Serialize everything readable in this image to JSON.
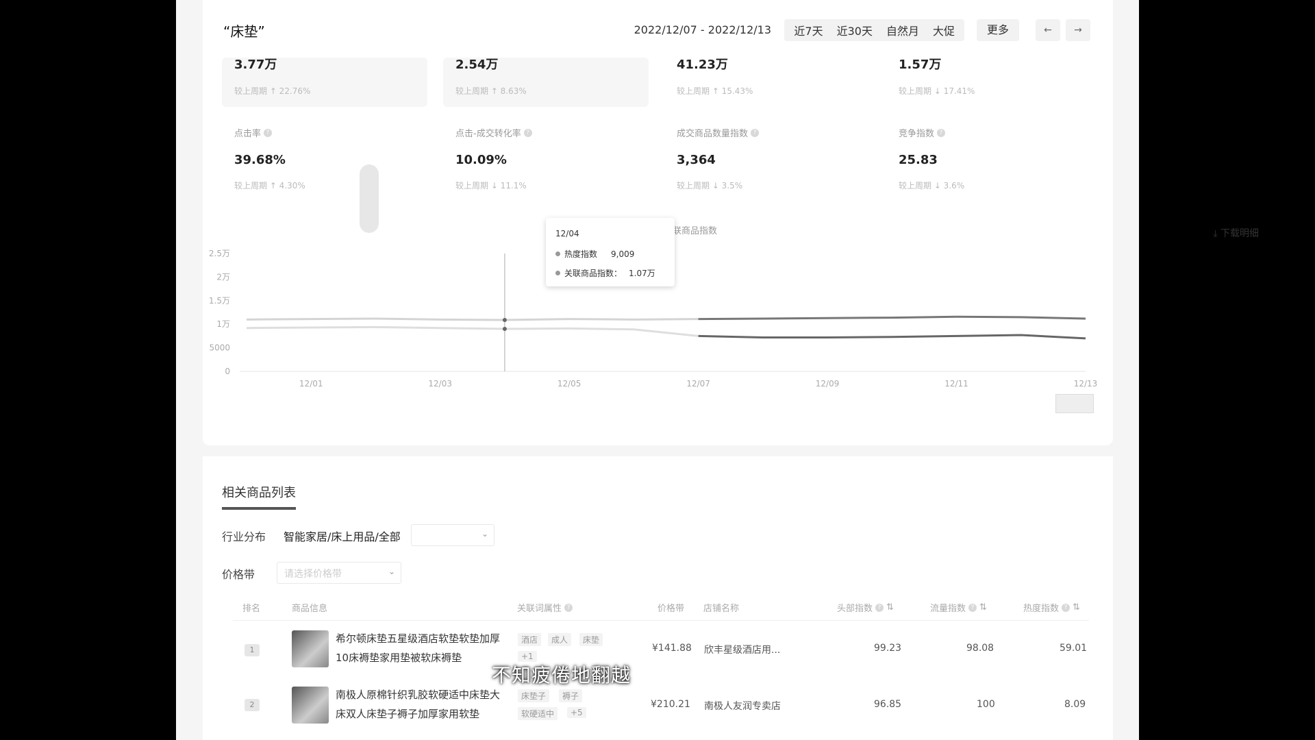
{
  "header": {
    "keyword": "“床垫”",
    "date_range": "2022/12/07 - 2022/12/13",
    "range_tabs": [
      "近7天",
      "近30天",
      "自然月",
      "大促"
    ],
    "more": "更多",
    "prev": "←",
    "next": "→"
  },
  "metrics_top": [
    {
      "value": "3.77万",
      "compare": "较上周期 ↑ 22.76%"
    },
    {
      "value": "2.54万",
      "compare": "较上周期 ↑ 8.63%"
    },
    {
      "value": "41.23万",
      "compare": "较上周期 ↑ 15.43%"
    },
    {
      "value": "1.57万",
      "compare": "较上周期 ↓ 17.41%"
    }
  ],
  "metrics_bottom": [
    {
      "name": "点击率",
      "value": "39.68%",
      "compare": "较上周期 ↑ 4.30%"
    },
    {
      "name": "点击-成交转化率",
      "value": "10.09%",
      "compare": "较上周期 ↓ 11.1%"
    },
    {
      "name": "成交商品数量指数",
      "value": "3,364",
      "compare": "较上周期 ↓ 3.5%"
    },
    {
      "name": "竞争指数",
      "value": "25.83",
      "compare": "较上周期 ↓ 3.6%"
    }
  ],
  "chart": {
    "legend_partial": "联商品指数",
    "download": "下载明细",
    "chart_data": {
      "type": "line",
      "x": [
        "11/30",
        "12/01",
        "12/02",
        "12/03",
        "12/04",
        "12/05",
        "12/06",
        "12/07",
        "12/08",
        "12/09",
        "12/10",
        "12/11",
        "12/12",
        "12/13"
      ],
      "x_tick_labels": [
        "12/01",
        "12/03",
        "12/05",
        "12/07",
        "12/09",
        "12/11",
        "12/13"
      ],
      "y_tick_labels": [
        "0",
        "5000",
        "1万",
        "1.5万",
        "2万",
        "2.5万"
      ],
      "ylim": [
        0,
        25000
      ],
      "series": [
        {
          "name": "热度指数",
          "values": [
            11000,
            11100,
            11200,
            11000,
            10900,
            11100,
            11000,
            11100,
            11200,
            11300,
            11400,
            11600,
            11500,
            11200
          ]
        },
        {
          "name": "关联商品指数",
          "values": [
            9200,
            9300,
            9400,
            9200,
            9009,
            9100,
            8900,
            7500,
            7200,
            7200,
            7300,
            7500,
            7700,
            7000
          ]
        }
      ],
      "highlight_index": 4
    },
    "tooltip": {
      "date": "12/04",
      "rows": [
        {
          "label": "热度指数",
          "value": "9,009"
        },
        {
          "label": "关联商品指数：",
          "value": "1.07万"
        }
      ]
    }
  },
  "products": {
    "section_title": "相关商品列表",
    "industry_label": "行业分布",
    "industry_value": "智能家居/床上用品/全部",
    "price_label": "价格带",
    "price_placeholder": "请选择价格带",
    "columns": [
      "排名",
      "商品信息",
      "关联词属性",
      "价格带",
      "店铺名称",
      "头部指数",
      "流量指数",
      "热度指数"
    ],
    "rows": [
      {
        "rank": "1",
        "name": "希尔顿床垫五星级酒店软垫软垫加厚10床褥垫家用垫被软床褥垫",
        "tags": [
          "酒店",
          "成人",
          "床垫"
        ],
        "extra_tag": "+1",
        "price": "¥141.88",
        "shop": "欣丰星级酒店用...",
        "idx1": "99.23",
        "idx2": "98.08",
        "idx3": "59.01"
      },
      {
        "rank": "2",
        "name": "南极人原棉针织乳胶软硬适中床垫大床双人床垫子褥子加厚家用软垫",
        "tags": [
          "床垫子",
          "褥子",
          "软硬适中",
          "+5"
        ],
        "extra_tag": "",
        "price": "¥210.21",
        "shop": "南极人友润专卖店",
        "idx1": "96.85",
        "idx2": "100",
        "idx3": "8.09"
      }
    ]
  },
  "subtitle": "不知疲倦地翻越"
}
